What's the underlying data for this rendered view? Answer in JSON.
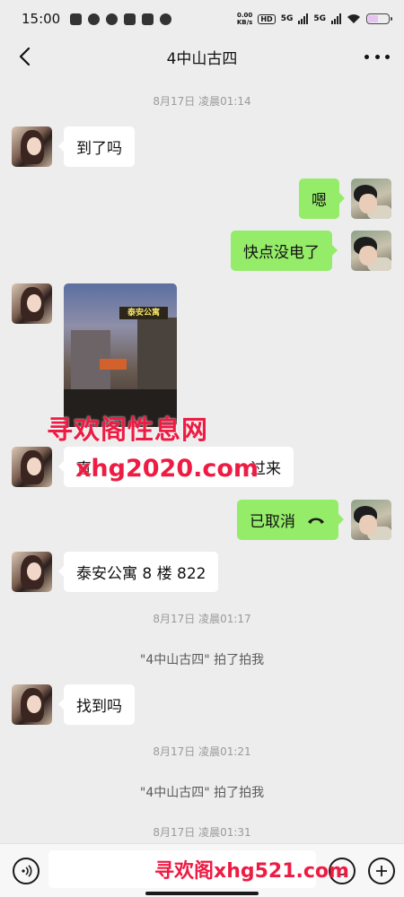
{
  "status_bar": {
    "time": "15:00",
    "net_speed_value": "0.00",
    "net_speed_unit": "KB/s",
    "hd_label": "HD",
    "net1": "5G",
    "net2": "5G",
    "battery_level": 0.5
  },
  "nav": {
    "title": "4中山古四"
  },
  "messages": {
    "ts1": "8月17日 凌晨01:14",
    "m1": "到了吗",
    "m2": "嗯",
    "m3": "快点没电了",
    "photo_sign": "泰安公寓",
    "m5_partial_1": "直",
    "m5_partial_2": "过来",
    "m6": "已取消",
    "m7": "泰安公寓 8 楼 822",
    "ts2": "8月17日 凌晨01:17",
    "sys1": "\"4中山古四\" 拍了拍我",
    "m8": "找到吗",
    "ts3": "8月17日 凌晨01:21",
    "sys2": "\"4中山古四\" 拍了拍我",
    "ts4": "8月17日 凌晨01:31"
  },
  "watermarks": {
    "w1": "寻欢阁性息网",
    "w2": "xhg2020.com",
    "w3": "寻欢阁xhg521.com"
  },
  "colors": {
    "bubble_sent": "#95ec69",
    "bubble_received": "#ffffff",
    "background": "#ededed",
    "watermark": "#ee1b43"
  }
}
